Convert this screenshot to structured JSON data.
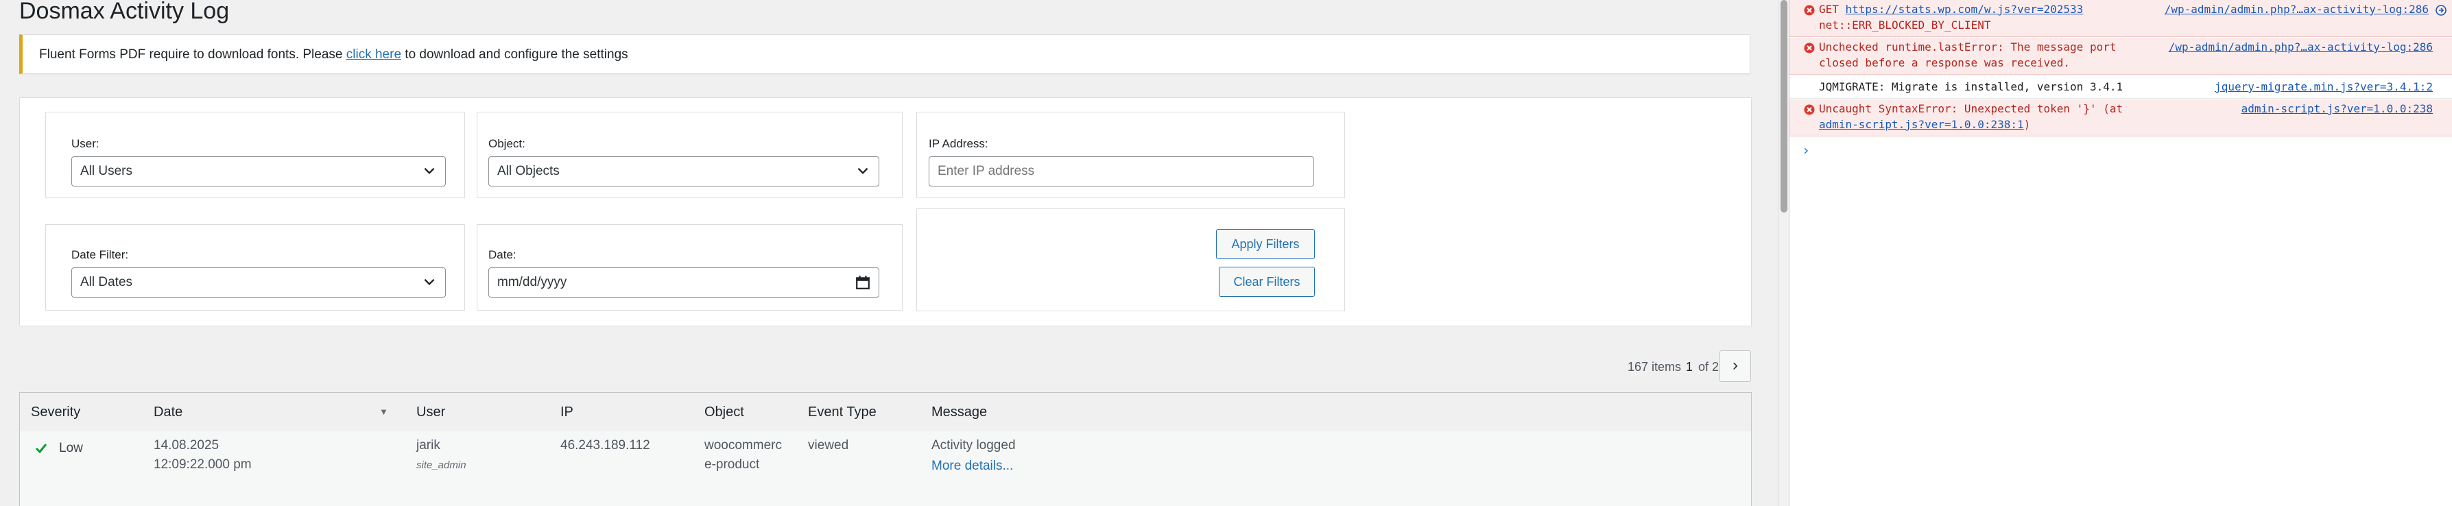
{
  "page": {
    "title": "Dosmax Activity Log",
    "notice": {
      "prefix": "Fluent Forms PDF require to download fonts. Please ",
      "link": "click here",
      "suffix": " to download and configure the settings"
    }
  },
  "filters": {
    "user": {
      "label": "User:",
      "value": "All Users"
    },
    "object": {
      "label": "Object:",
      "value": "All Objects"
    },
    "ip": {
      "label": "IP Address:",
      "placeholder": "Enter IP address"
    },
    "date_filter": {
      "label": "Date Filter:",
      "value": "All Dates"
    },
    "date": {
      "label": "Date:",
      "value": "mm/dd/yyyy"
    },
    "apply_label": "Apply Filters",
    "clear_label": "Clear Filters"
  },
  "pagination": {
    "items": "167 items",
    "current": "1",
    "of": "of 2",
    "next": "›"
  },
  "table": {
    "headers": [
      "Severity",
      "Date",
      "User",
      "IP",
      "Object",
      "Event Type",
      "Message"
    ],
    "sort_indicator": "▼",
    "rows": [
      {
        "severity": "Low",
        "date": "14.08.2025",
        "time": "12:09:22.000 pm",
        "user": "jarik",
        "role": "site_admin",
        "ip": "46.243.189.112",
        "object_line1": "woocommerc",
        "object_line2": "e-product",
        "event_type": "viewed",
        "message": "Activity logged",
        "details_link": "More details..."
      }
    ]
  },
  "console": {
    "messages": [
      {
        "type": "error",
        "line1_prefix": "GET ",
        "line1_link": "https://stats.wp.com/w.js?ver=202533",
        "line2": "net::ERR_BLOCKED_BY_CLIENT",
        "source": "/wp-admin/admin.php?…ax-activity-log:286"
      },
      {
        "type": "error",
        "line1": "Unchecked runtime.lastError: The message port",
        "line2": "closed before a response was received.",
        "source": "/wp-admin/admin.php?…ax-activity-log:286"
      },
      {
        "type": "log",
        "line1": "JQMIGRATE: Migrate is installed, version 3.4.1",
        "source": "jquery-migrate.min.js?ver=3.4.1:2"
      },
      {
        "type": "error",
        "line1": "Uncaught SyntaxError: Unexpected token '}' (at",
        "line2_link": "admin-script.js?ver=1.0.0:238:1",
        "line2_suffix": ")",
        "source": "admin-script.js?ver=1.0.0:238"
      }
    ],
    "prompt": "›"
  },
  "colors": {
    "accent": "#2271b1",
    "notice_border": "#dba617",
    "error_bg": "#fcebeb",
    "error_text": "#b3261e",
    "check_green": "#00a32a"
  }
}
